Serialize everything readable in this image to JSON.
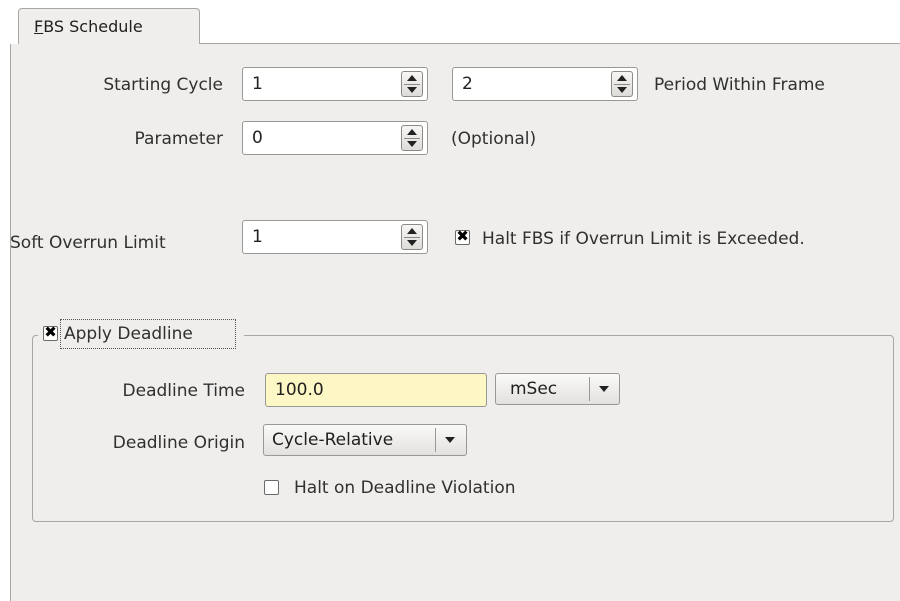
{
  "tab": {
    "label": "FBS Schedule",
    "accel": "F",
    "rest": "BS Schedule"
  },
  "starting_cycle": {
    "label": "Starting Cycle",
    "value": "1"
  },
  "period": {
    "value": "2",
    "label": "Period Within Frame"
  },
  "parameter": {
    "label": "Parameter",
    "value": "0",
    "hint": "(Optional)"
  },
  "soft_overrun": {
    "label": "Soft Overrun Limit",
    "value": "1"
  },
  "halt_fbs": {
    "label": "Halt FBS if Overrun Limit is Exceeded.",
    "checked": true
  },
  "apply_deadline": {
    "label": "Apply Deadline",
    "checked": true
  },
  "deadline_time": {
    "label": "Deadline Time",
    "value": "100.0",
    "unit": "mSec"
  },
  "deadline_origin": {
    "label": "Deadline Origin",
    "value": "Cycle-Relative"
  },
  "halt_deadline": {
    "label": "Halt on Deadline Violation",
    "checked": false
  },
  "check_glyph": "✖",
  "colors": {
    "panel": "#efeeec",
    "highlight_field": "#fdf6c5"
  }
}
